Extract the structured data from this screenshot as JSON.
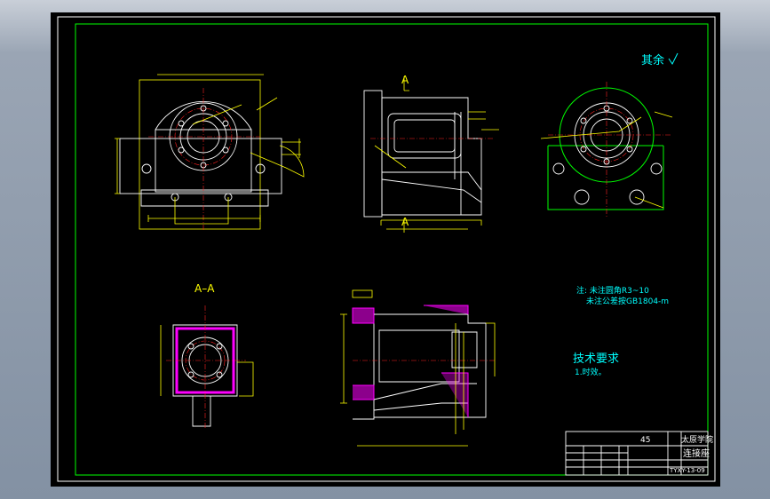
{
  "drawing": {
    "section_label": "A–A",
    "view_mark_top": "A",
    "view_mark_bottom": "A",
    "roughness_note": "其余",
    "notes_line1": "注: 未注圆角R3~10",
    "notes_line2": "未注公差按GB1804-m",
    "tech_title": "技术要求",
    "tech_item1": "1.时效。",
    "title_block": {
      "material": "45",
      "school": "太原学院",
      "part_name": "连接座",
      "drawing_no": "TYXY-13-09"
    }
  },
  "colors": {
    "frame": "#00ff00",
    "part_outline": "#ffff00",
    "center_line": "#ff2020",
    "section_hatch": "#ff00ff",
    "text_cyan": "#00ffff"
  }
}
